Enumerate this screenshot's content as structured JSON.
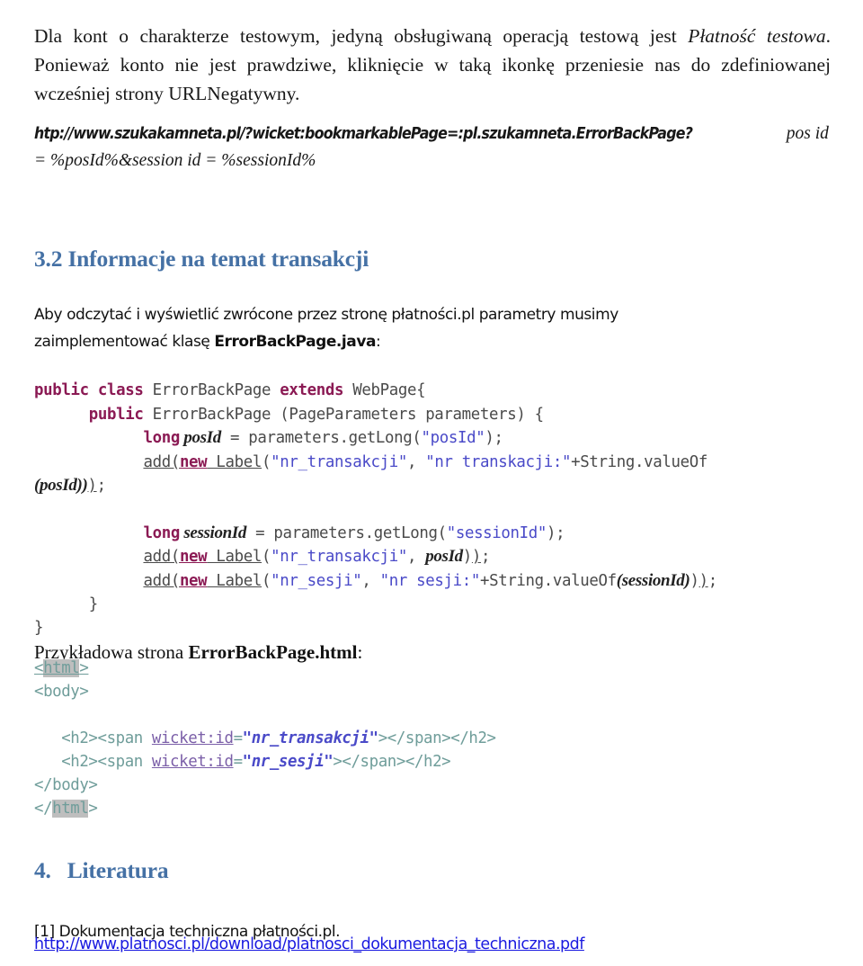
{
  "document": {
    "intro_paragraph": {
      "seg1": "Dla kont o charakterze testowym, jedyną obsługiwaną operacją testową jest ",
      "seg2_italic": "Płatność testowa",
      "seg3": ". Ponieważ konto nie jest prawdziwe, kliknięcie w taką ikonkę przeniesie nas do zdefiniowanej wcześniej strony URLNegatywny."
    },
    "url_block": {
      "condensed_part": "htp://www.szukakamneta.pl/?wicket:bookmarkablePage=:pl.szukamneta.ErrorBackPage?",
      "serif_part": " pos id = %posId%&session id = %sessionId%"
    },
    "heading_32": "3.2 Informacje na temat transakcji",
    "paragraph_aby": {
      "seg1": "Aby odczytać i wyświetlić zwrócone przez stronę płatności.pl parametry musimy zaimplementować klasę ",
      "seg2_bold": "ErrorBackPage.java",
      "seg3": ":"
    },
    "java_code": {
      "l1_kw1": "public class",
      "l1_name": " ErrorBackPage ",
      "l1_kw2": "extends",
      "l1_rest": " WebPage{",
      "l2_indent": "      ",
      "l2_kw": "public",
      "l2_rest": " ErrorBackPage (PageParameters parameters) {",
      "l3_indent": "            ",
      "l3_kw": "long",
      "l3_var": " posId",
      "l3_mid": " = parameters.getLong(",
      "l3_str": "\"posId\"",
      "l3_end": ");",
      "l4_indent": "            ",
      "l4_add": "add(",
      "l4_kw": "new",
      "l4_label": " Label",
      "l4_open": "(",
      "l4_str1": "\"nr_transakcji\"",
      "l4_comma": ", ",
      "l4_str2": "\"nr transkacji:\"",
      "l4_tail": "+String.valueOf",
      "l5_wrap_var": "(posId))",
      "l5_wrap_end": ")",
      "l5_semi": ";",
      "l6_indent": "            ",
      "l6_kw": "long",
      "l6_var": " sessionId",
      "l6_mid": " = parameters.getLong(",
      "l6_str": "\"sessionId\"",
      "l6_end": ");",
      "l7_indent": "            ",
      "l7_add": "add(",
      "l7_kw": "new",
      "l7_label": " Label",
      "l7_open": "(",
      "l7_str1": "\"nr_transakcji\"",
      "l7_comma": ", ",
      "l7_var": "posId",
      "l7_close": ")",
      "l7_close2": ")",
      "l7_semi": ";",
      "l8_indent": "            ",
      "l8_add": "add(",
      "l8_kw": "new",
      "l8_label": " Label",
      "l8_open": "(",
      "l8_str1": "\"nr_sesji\"",
      "l8_comma": ", ",
      "l8_str2": "\"nr sesji:\"",
      "l8_tail": "+String.valueOf",
      "l8_var": "(sessionId)",
      "l8_close": ")",
      "l8_close2": ")",
      "l8_semi": ";",
      "l9": "      }",
      "l10": "}"
    },
    "paragraph_przykladowa": {
      "seg1": "Przykładowa strona ",
      "seg2_bold": "ErrorBackPage.html",
      "seg3": ":"
    },
    "html_code": {
      "l1_open": "<",
      "l1_tagname": "html",
      "l1_close": ">",
      "l2": "<body>",
      "l3_indent": "   ",
      "l3_tags_open": "<h2><span ",
      "l3_attr": "wicket:id",
      "l3_eq": "=",
      "l3_val": "\"nr_transakcji\"",
      "l3_tags_close": "></span></h2>",
      "l4_indent": "   ",
      "l4_tags_open": "<h2><span ",
      "l4_attr": "wicket:id",
      "l4_eq": "=",
      "l4_val": "\"nr_sesji\"",
      "l4_tags_close": "></span></h2>",
      "l5": "</body>",
      "l6_open": "</",
      "l6_tagname": "html",
      "l6_close": ">"
    },
    "heading_4": {
      "number": "4.",
      "text": "Literatura"
    },
    "literature_ref": "[1] Dokumentacja techniczna płatności.pl.",
    "literature_link": "http://www.platnosci.pl/download/platnosci_dokumentacja_techniczna.pdf"
  },
  "colors": {
    "heading_blue": "#4571A5",
    "keyword_magenta": "#8B1A54",
    "string_blue": "#4A4AC8",
    "code_gray": "#4A4A4A",
    "html_tag_teal": "#6F9D9A",
    "attr_purple": "#7B5FA8",
    "link_blue": "#1A1AE0",
    "highlight_gray": "#BEBEBE"
  }
}
